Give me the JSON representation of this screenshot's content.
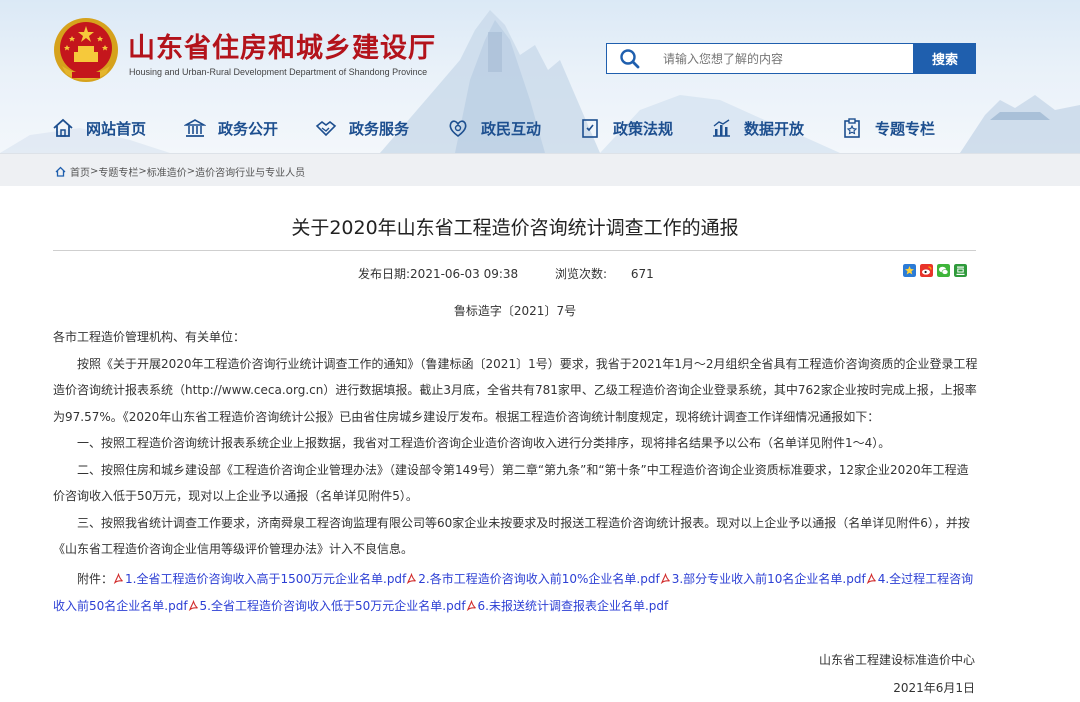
{
  "header": {
    "title": "山东省住房和城乡建设厅",
    "subtitle": "Housing and Urban-Rural Development Department of Shandong Province",
    "search": {
      "placeholder": "请输入您想了解的内容",
      "button": "搜索"
    },
    "nav": [
      {
        "label": "网站首页",
        "icon": "home-icon"
      },
      {
        "label": "政务公开",
        "icon": "building-icon"
      },
      {
        "label": "政务服务",
        "icon": "handshake-icon"
      },
      {
        "label": "政民互动",
        "icon": "interaction-icon"
      },
      {
        "label": "政策法规",
        "icon": "policy-icon"
      },
      {
        "label": "数据开放",
        "icon": "chart-icon"
      },
      {
        "label": "专题专栏",
        "icon": "topic-icon"
      }
    ]
  },
  "breadcrumb": [
    "首页",
    "专题专栏",
    "标准造价",
    "造价咨询行业与专业人员"
  ],
  "article": {
    "title": "关于2020年山东省工程造价咨询统计调查工作的通报",
    "publish_label": "发布日期:",
    "publish_date": "2021-06-03 09:38",
    "views_label": "浏览次数:",
    "views": "671",
    "doc_number": "鲁标造字〔2021〕7号",
    "salutation": "各市工程造价管理机构、有关单位：",
    "paragraphs": [
      "按照《关于开展2020年工程造价咨询行业统计调查工作的通知》（鲁建标函〔2021〕1号）要求，我省于2021年1月～2月组织全省具有工程造价咨询资质的企业登录工程造价咨询统计报表系统（http://www.ceca.org.cn）进行数据填报。截止3月底，全省共有781家甲、乙级工程造价咨询企业登录系统，其中762家企业按时完成上报，上报率为97.57%。《2020年山东省工程造价咨询统计公报》已由省住房城乡建设厅发布。根据工程造价咨询统计制度规定，现将统计调查工作详细情况通报如下：",
      "一、按照工程造价咨询统计报表系统企业上报数据，我省对工程造价咨询企业造价咨询收入进行分类排序，现将排名结果予以公布（名单详见附件1～4）。",
      "二、按照住房和城乡建设部《工程造价咨询企业管理办法》（建设部令第149号）第二章“第九条”和“第十条”中工程造价咨询企业资质标准要求，12家企业2020年工程造价咨询收入低于50万元，现对以上企业予以通报（名单详见附件5）。",
      "三、按照我省统计调查工作要求，济南舜泉工程咨询监理有限公司等60家企业未按要求及时报送工程造价咨询统计报表。现对以上企业予以通报（名单详见附件6），并按《山东省工程造价咨询企业信用等级评价管理办法》计入不良信息。"
    ],
    "attachments_label": "附件：",
    "attachments": [
      "1.全省工程造价咨询收入高于1500万元企业名单.pdf",
      "2.各市工程造价咨询收入前10%企业名单.pdf",
      "3.部分专业收入前10名企业名单.pdf",
      "4.全过程工程咨询收入前50名企业名单.pdf",
      "5.全省工程造价咨询收入低于50万元企业名单.pdf",
      "6.未报送统计调查报表企业名单.pdf"
    ],
    "signer": "山东省工程建设标准造价中心",
    "sign_date": "2021年6月1日"
  },
  "colors": {
    "brand_red": "#b3131b",
    "nav_blue": "#1d4f8f",
    "button_blue": "#1f5fae",
    "link_blue": "#2c3fd4"
  }
}
